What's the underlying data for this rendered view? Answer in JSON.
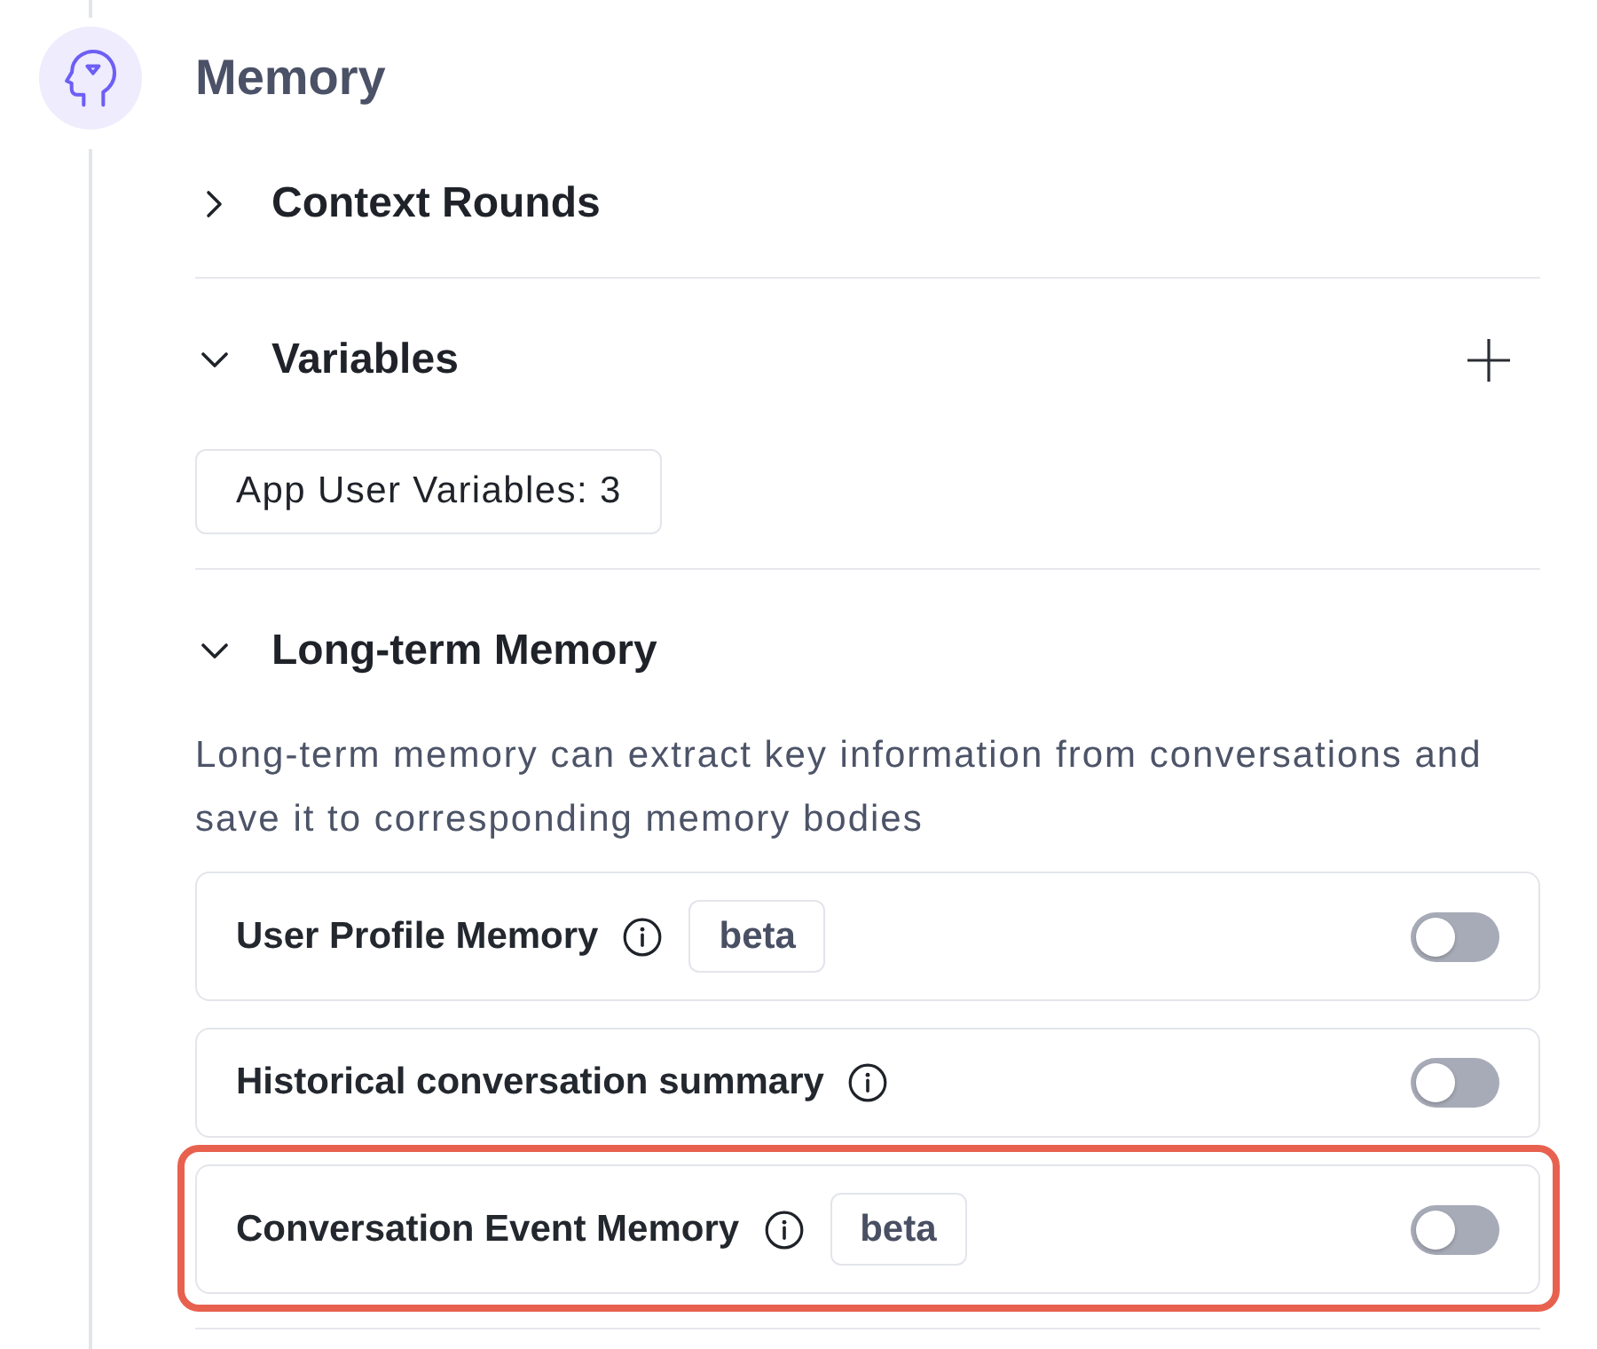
{
  "section": {
    "title": "Memory"
  },
  "groups": [
    {
      "title": "Context Rounds",
      "expanded": false
    },
    {
      "title": "Variables",
      "expanded": true,
      "add_action": true,
      "variables_button": "App User Variables: 3"
    },
    {
      "title": "Long-term Memory",
      "expanded": true,
      "description": "Long-term memory can extract key information from conversations and save it to corresponding memory bodies",
      "features": [
        {
          "label": "User Profile Memory",
          "info": true,
          "badge": "beta",
          "on": false,
          "highlighted": false
        },
        {
          "label": "Historical conversation summary",
          "info": true,
          "on": false,
          "highlighted": false
        },
        {
          "label": "Conversation Event Memory",
          "info": true,
          "badge": "beta",
          "on": false,
          "highlighted": true
        }
      ]
    }
  ]
}
